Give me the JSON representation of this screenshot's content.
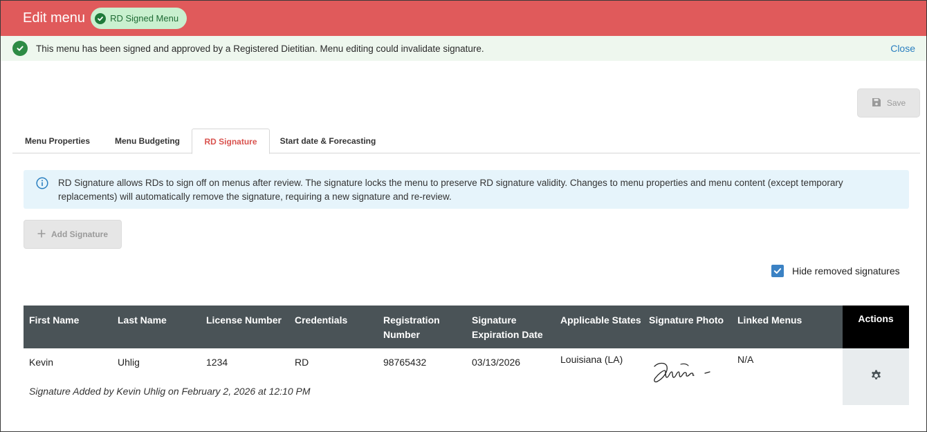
{
  "header": {
    "title": "Edit menu",
    "badge_label": "RD Signed Menu"
  },
  "alert": {
    "message": "This menu has been signed and approved by a Registered Dietitian. Menu editing could invalidate signature.",
    "close_label": "Close"
  },
  "toolbar": {
    "save_label": "Save"
  },
  "tabs": [
    {
      "label": "Menu Properties"
    },
    {
      "label": "Menu Budgeting"
    },
    {
      "label": "RD Signature",
      "active": true
    },
    {
      "label": "Start date & Forecasting"
    }
  ],
  "info": {
    "text": "RD Signature allows RDs to sign off on menus after review. The signature locks the menu to preserve RD signature validity. Changes to menu properties and menu content (except temporary replacements) will automatically remove the signature, requiring a new signature and re-review."
  },
  "add_signature_label": "Add Signature",
  "hide_removed": {
    "label": "Hide removed signatures",
    "checked": true
  },
  "table": {
    "headers": {
      "first_name": "First Name",
      "last_name": "Last Name",
      "license_number": "License Number",
      "credentials": "Credentials",
      "registration_number_1": "Registration",
      "registration_number_2": "Number",
      "expiration_1": "Signature",
      "expiration_2": "Expiration Date",
      "states": "Applicable States",
      "photo": "Signature Photo",
      "linked_menus": "Linked Menus",
      "actions": "Actions"
    },
    "rows": [
      {
        "first_name": "Kevin",
        "last_name": "Uhlig",
        "license_number": "1234",
        "credentials": "RD",
        "registration_number": "98765432",
        "expiration_date": "03/13/2026",
        "states": "Louisiana (LA)",
        "linked_menus": "N/A",
        "note": "Signature Added by Kevin Uhlig on February 2, 2026 at 12:10 PM"
      }
    ]
  },
  "colors": {
    "header_bg": "#e05a5b",
    "alert_bg": "#eef7ee",
    "active_tab": "#d9534f",
    "info_bg": "#e6f4fb",
    "table_header_bg": "#4a5357",
    "link": "#2a7fc0"
  },
  "icons": {
    "badge": "check-circle-icon",
    "alert": "check-circle-icon",
    "save": "floppy-disk-icon",
    "info": "info-circle-icon",
    "add": "plus-icon",
    "checkbox": "checkmark-icon",
    "actions": "gear-icon"
  }
}
